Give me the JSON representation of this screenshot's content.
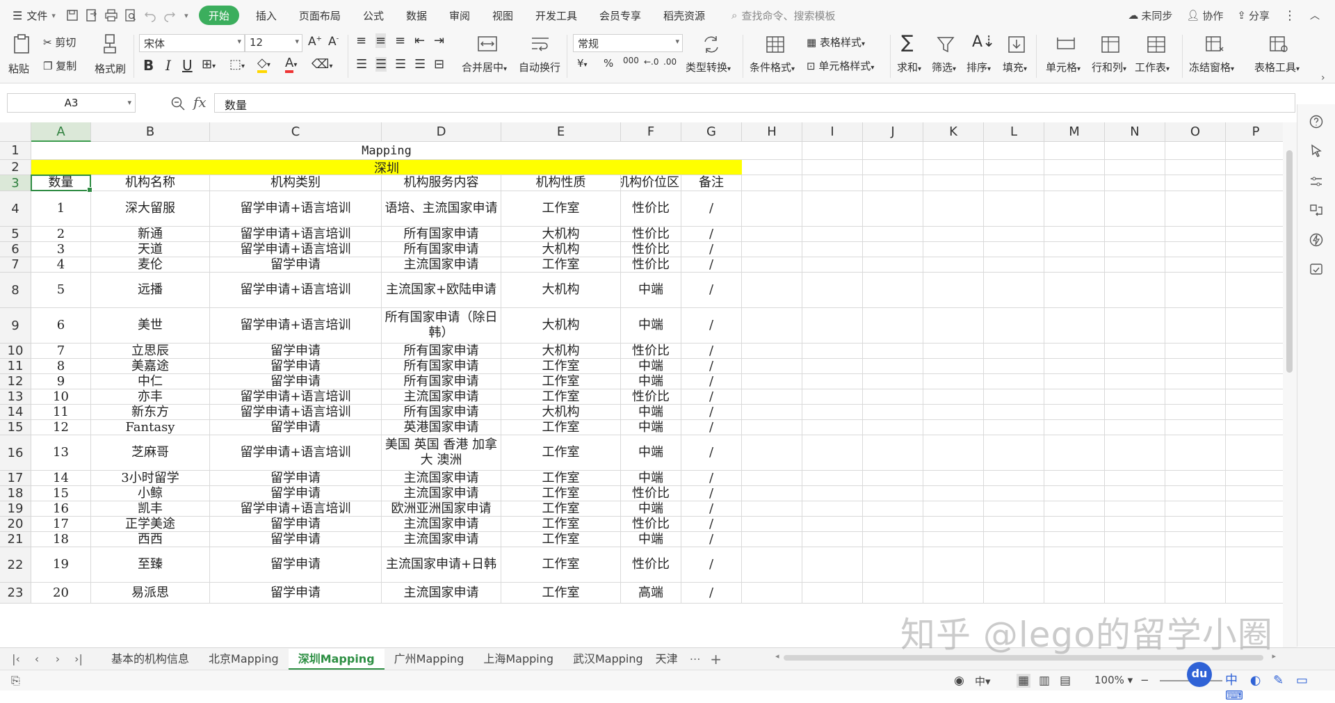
{
  "menubar": {
    "file_label": "文件",
    "tabs": [
      "开始",
      "插入",
      "页面布局",
      "公式",
      "数据",
      "审阅",
      "视图",
      "开发工具",
      "会员专享",
      "稻壳资源"
    ],
    "active_tab": "开始",
    "search_placeholder": "查找命令、搜索模板",
    "sync_label": "未同步",
    "collab_label": "协作",
    "share_label": "分享"
  },
  "ribbon": {
    "paste": "粘贴",
    "cut": "剪切",
    "copy": "复制",
    "format_painter": "格式刷",
    "font_name": "宋体",
    "font_size": "12",
    "merge_center": "合并居中",
    "wrap_text": "自动换行",
    "number_format": "常规",
    "type_convert": "类型转换",
    "conditional_format": "条件格式",
    "table_style": "表格样式",
    "cell_style": "单元格样式",
    "sum": "求和",
    "filter": "筛选",
    "sort": "排序",
    "fill": "填充",
    "cells": "单元格",
    "row_col": "行和列",
    "worksheet": "工作表",
    "freeze": "冻结窗格",
    "table_tools": "表格工具",
    "percent": "%",
    "thousands": "000",
    "yuan": "¥"
  },
  "formula_bar": {
    "cell_ref": "A3",
    "fx": "fx",
    "content": "数量"
  },
  "columns": [
    "A",
    "B",
    "C",
    "D",
    "E",
    "F",
    "G",
    "H",
    "I",
    "J",
    "K",
    "L",
    "M",
    "N",
    "O",
    "P"
  ],
  "selected_column": "A",
  "selected_row": "3",
  "sheet": {
    "title": "Mapping",
    "city": "深圳",
    "headers": [
      "数量",
      "机构名称",
      "机构类别",
      "机构服务内容",
      "机构性质",
      "机构价位区",
      "备注"
    ],
    "rows": [
      {
        "n": "1",
        "name": "深大留服",
        "type": "留学申请+语言培训",
        "service": "语培、主流国家申请",
        "nature": "工作室",
        "price": "性价比",
        "note": "/"
      },
      {
        "n": "2",
        "name": "新通",
        "type": "留学申请+语言培训",
        "service": "所有国家申请",
        "nature": "大机构",
        "price": "性价比",
        "note": "/"
      },
      {
        "n": "3",
        "name": "天道",
        "type": "留学申请+语言培训",
        "service": "所有国家申请",
        "nature": "大机构",
        "price": "性价比",
        "note": "/"
      },
      {
        "n": "4",
        "name": "麦伦",
        "type": "留学申请",
        "service": "主流国家申请",
        "nature": "工作室",
        "price": "性价比",
        "note": "/"
      },
      {
        "n": "5",
        "name": "远播",
        "type": "留学申请+语言培训",
        "service": "主流国家+欧陆申请",
        "nature": "大机构",
        "price": "中端",
        "note": "/"
      },
      {
        "n": "6",
        "name": "美世",
        "type": "留学申请+语言培训",
        "service": "所有国家申请（除日韩）",
        "nature": "大机构",
        "price": "中端",
        "note": "/"
      },
      {
        "n": "7",
        "name": "立思辰",
        "type": "留学申请",
        "service": "所有国家申请",
        "nature": "大机构",
        "price": "性价比",
        "note": "/"
      },
      {
        "n": "8",
        "name": "美嘉途",
        "type": "留学申请",
        "service": "所有国家申请",
        "nature": "工作室",
        "price": "中端",
        "note": "/"
      },
      {
        "n": "9",
        "name": "中仁",
        "type": "留学申请",
        "service": "所有国家申请",
        "nature": "工作室",
        "price": "中端",
        "note": "/"
      },
      {
        "n": "10",
        "name": "亦丰",
        "type": "留学申请+语言培训",
        "service": "主流国家申请",
        "nature": "工作室",
        "price": "性价比",
        "note": "/"
      },
      {
        "n": "11",
        "name": "新东方",
        "type": "留学申请+语言培训",
        "service": "所有国家申请",
        "nature": "大机构",
        "price": "中端",
        "note": "/"
      },
      {
        "n": "12",
        "name": "Fantasy",
        "type": "留学申请",
        "service": "英港国家申请",
        "nature": "工作室",
        "price": "中端",
        "note": "/"
      },
      {
        "n": "13",
        "name": "芝麻哥",
        "type": "留学申请+语言培训",
        "service": "美国 英国 香港 加拿大 澳洲",
        "nature": "工作室",
        "price": "中端",
        "note": "/"
      },
      {
        "n": "14",
        "name": "3小时留学",
        "type": "留学申请",
        "service": "主流国家申请",
        "nature": "工作室",
        "price": "中端",
        "note": "/"
      },
      {
        "n": "15",
        "name": "小鲸",
        "type": "留学申请",
        "service": "主流国家申请",
        "nature": "工作室",
        "price": "性价比",
        "note": "/"
      },
      {
        "n": "16",
        "name": "凯丰",
        "type": "留学申请+语言培训",
        "service": "欧洲亚洲国家申请",
        "nature": "工作室",
        "price": "中端",
        "note": "/"
      },
      {
        "n": "17",
        "name": "正学美途",
        "type": "留学申请",
        "service": "主流国家申请",
        "nature": "工作室",
        "price": "性价比",
        "note": "/"
      },
      {
        "n": "18",
        "name": "西西",
        "type": "留学申请",
        "service": "主流国家申请",
        "nature": "工作室",
        "price": "中端",
        "note": "/"
      },
      {
        "n": "19",
        "name": "至臻",
        "type": "留学申请",
        "service": "主流国家申请+日韩",
        "nature": "工作室",
        "price": "性价比",
        "note": "/"
      },
      {
        "n": "20",
        "name": "易派思",
        "type": "留学申请",
        "service": "主流国家申请",
        "nature": "工作室",
        "price": "高端",
        "note": "/"
      }
    ]
  },
  "sheet_tabs": [
    "基本的机构信息",
    "北京Mapping",
    "深圳Mapping",
    "广州Mapping",
    "上海Mapping",
    "武汉Mapping",
    "天津"
  ],
  "active_sheet": "深圳Mapping",
  "statusbar": {
    "zoom": "100%",
    "ime": "中",
    "logo_text": "du"
  },
  "watermark": "知乎 @lego的留学小圈"
}
